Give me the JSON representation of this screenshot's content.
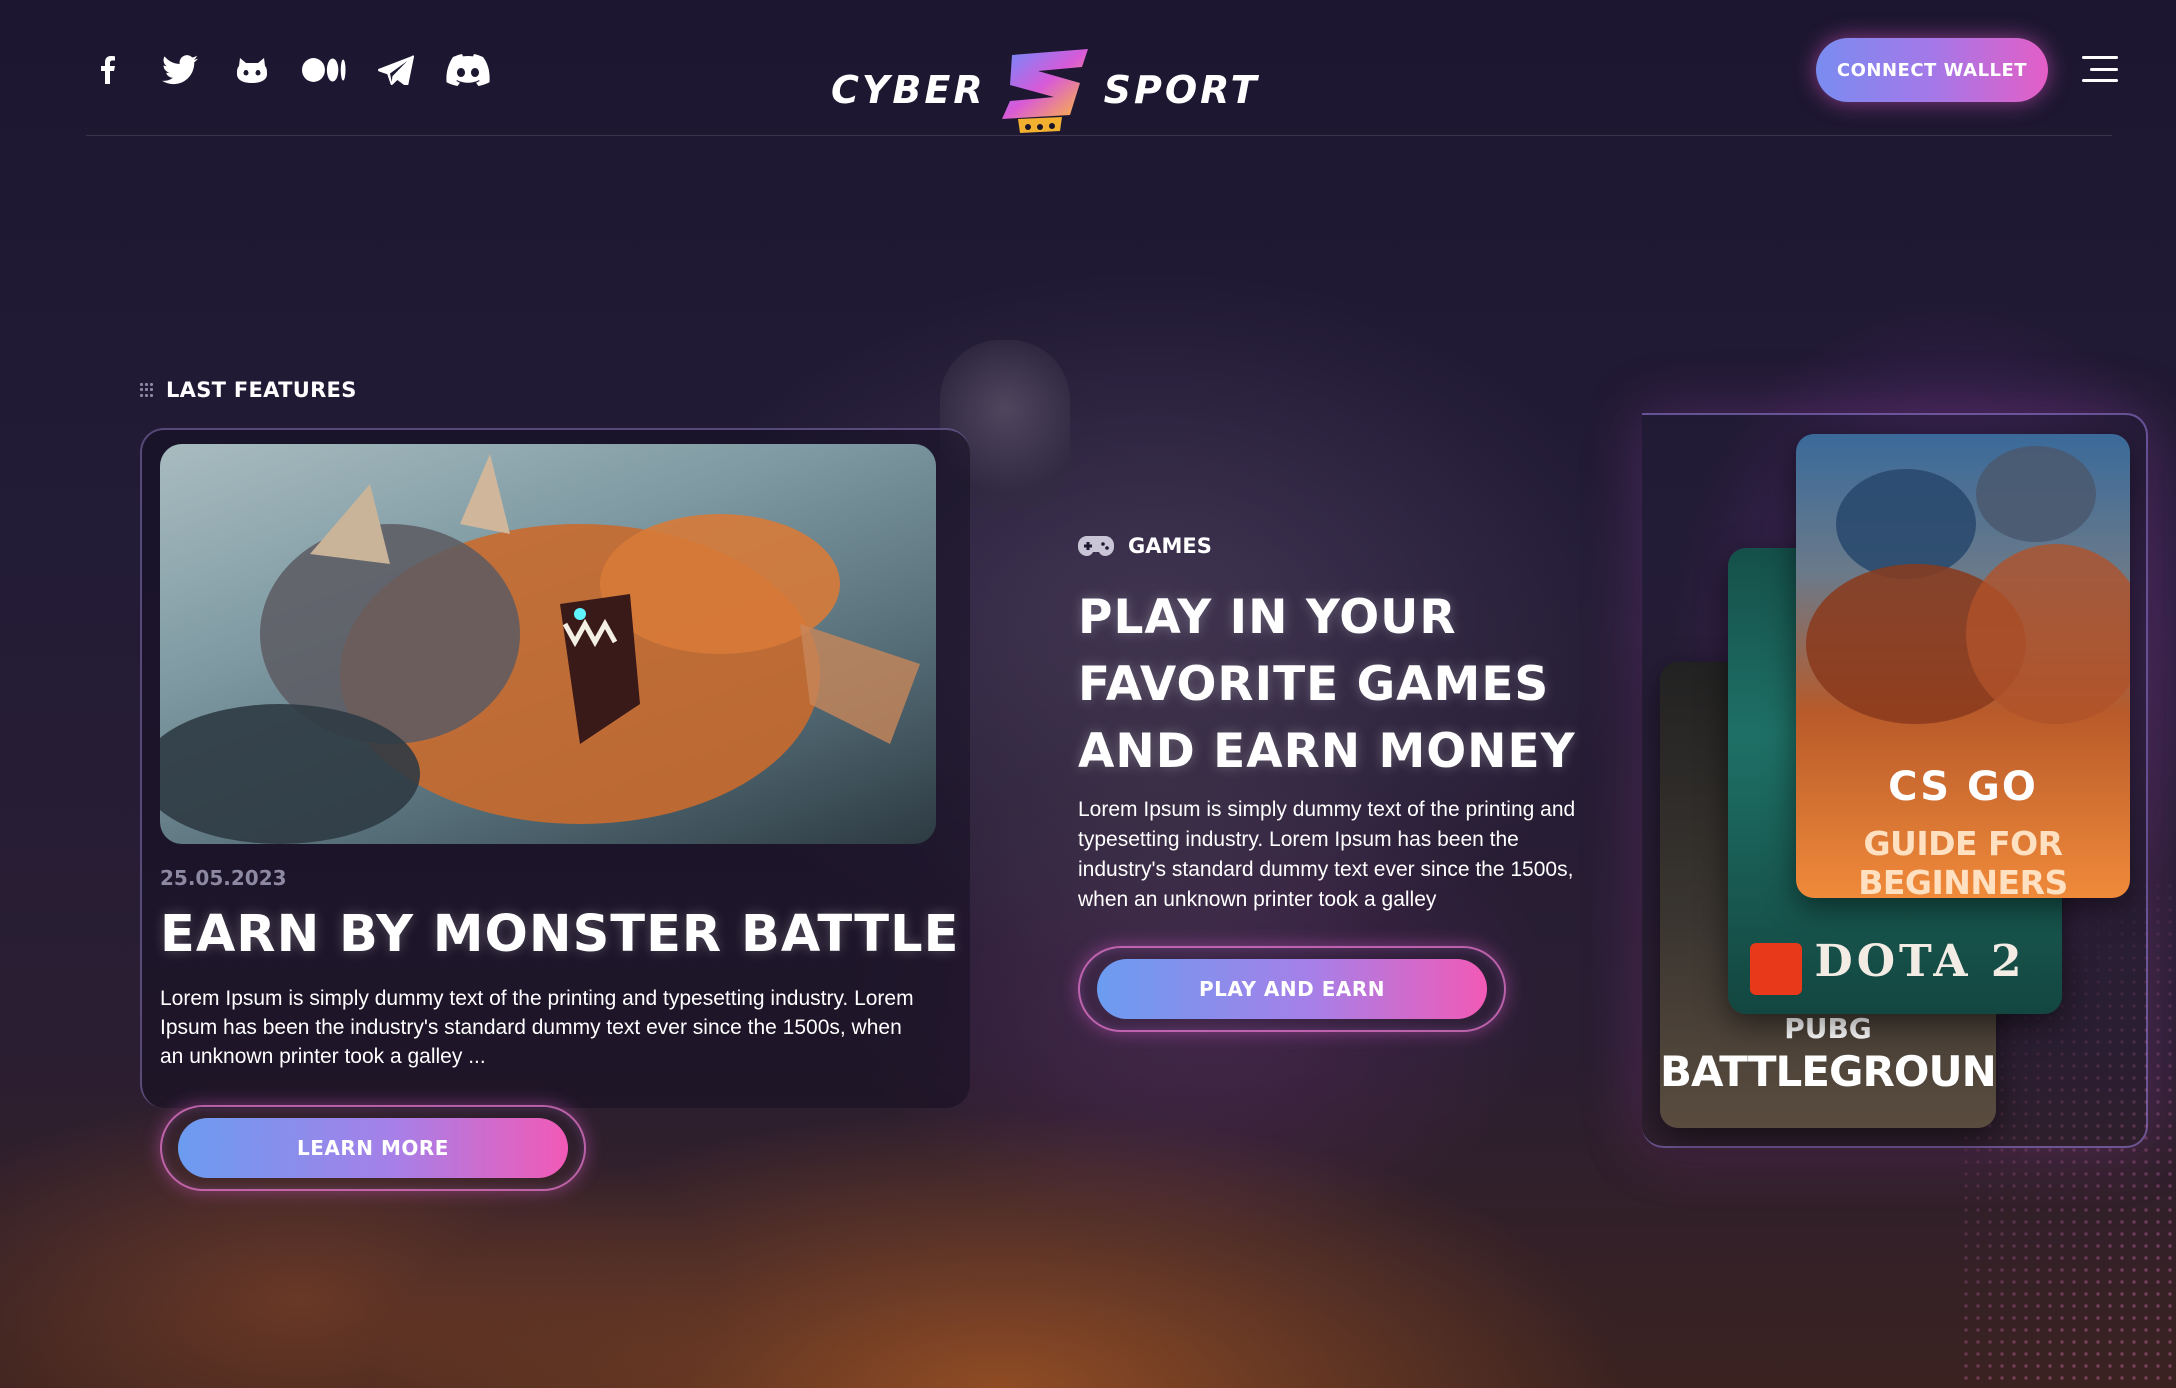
{
  "header": {
    "socials": [
      {
        "name": "facebook",
        "icon": "facebook-icon"
      },
      {
        "name": "twitter",
        "icon": "twitter-icon"
      },
      {
        "name": "github",
        "icon": "github-icon"
      },
      {
        "name": "medium",
        "icon": "medium-icon"
      },
      {
        "name": "telegram",
        "icon": "telegram-icon"
      },
      {
        "name": "discord",
        "icon": "discord-icon"
      }
    ],
    "logo_left": "CYBER",
    "logo_right": "SPORT",
    "connect_label": "CONNECT WALLET",
    "menu_icon": "hamburger-icon"
  },
  "features": {
    "section_label": "LAST FEATURES",
    "date": "25.05.2023",
    "title": "EARN BY MONSTER BATTLE",
    "description": "Lorem Ipsum is simply dummy text of the printing and typesetting industry. Lorem Ipsum has been the industry's standard dummy text ever since the 1500s, when an unknown printer took a galley ...",
    "button_label": "LEARN MORE"
  },
  "games": {
    "label": "GAMES",
    "icon": "gamepad-icon",
    "title": "PLAY IN YOUR FAVORITE GAMES AND EARN MONEY",
    "description": "Lorem Ipsum is simply dummy text of the printing and typesetting industry. Lorem Ipsum has been the industry's standard dummy text ever since the 1500s, when an unknown printer took a galley",
    "button_label": "PLAY AND EARN"
  },
  "cards": {
    "pubg_small": "PUBG",
    "pubg_big": "BATTLEGROUNDS",
    "dota": "DOTA 2",
    "cs_logo": "CS GO",
    "cs_sub": "GUIDE FOR BEGINNERS"
  },
  "colors": {
    "accent_start": "#6b9cf0",
    "accent_end": "#f25ab6",
    "background": "#1a1428"
  }
}
